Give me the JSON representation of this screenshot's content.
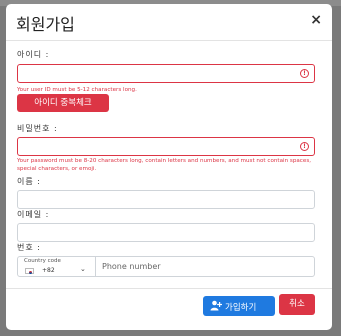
{
  "modal": {
    "title": "회원가입",
    "close_symbol": "×"
  },
  "form": {
    "user_id": {
      "label": "아이디 :",
      "value": "",
      "placeholder": "",
      "error": "Your user ID must be 5-12 characters long.",
      "check_button": "아이디 중복체크"
    },
    "password": {
      "label": "비밀번호 :",
      "value": "",
      "placeholder": "",
      "error": "Your password must be 8-20 characters long, contain letters and numbers, and must not contain spaces, special characters, or emoji."
    },
    "name": {
      "label": "이름 :",
      "value": ""
    },
    "email": {
      "label": "이메일 :",
      "value": ""
    },
    "phone": {
      "label": "번호 :",
      "country_label": "Country code",
      "country_code": "+82",
      "placeholder": "Phone number"
    }
  },
  "footer": {
    "join_button": "가입하기",
    "cancel_button": "취소"
  },
  "icons": {
    "error": "error-circle-icon",
    "close": "close-icon",
    "chevron": "chevron-down-icon",
    "add_user": "add-user-icon",
    "flag": "south-korea-flag-icon"
  },
  "colors": {
    "danger": "#dc3545",
    "primary": "#1f7ae0"
  }
}
